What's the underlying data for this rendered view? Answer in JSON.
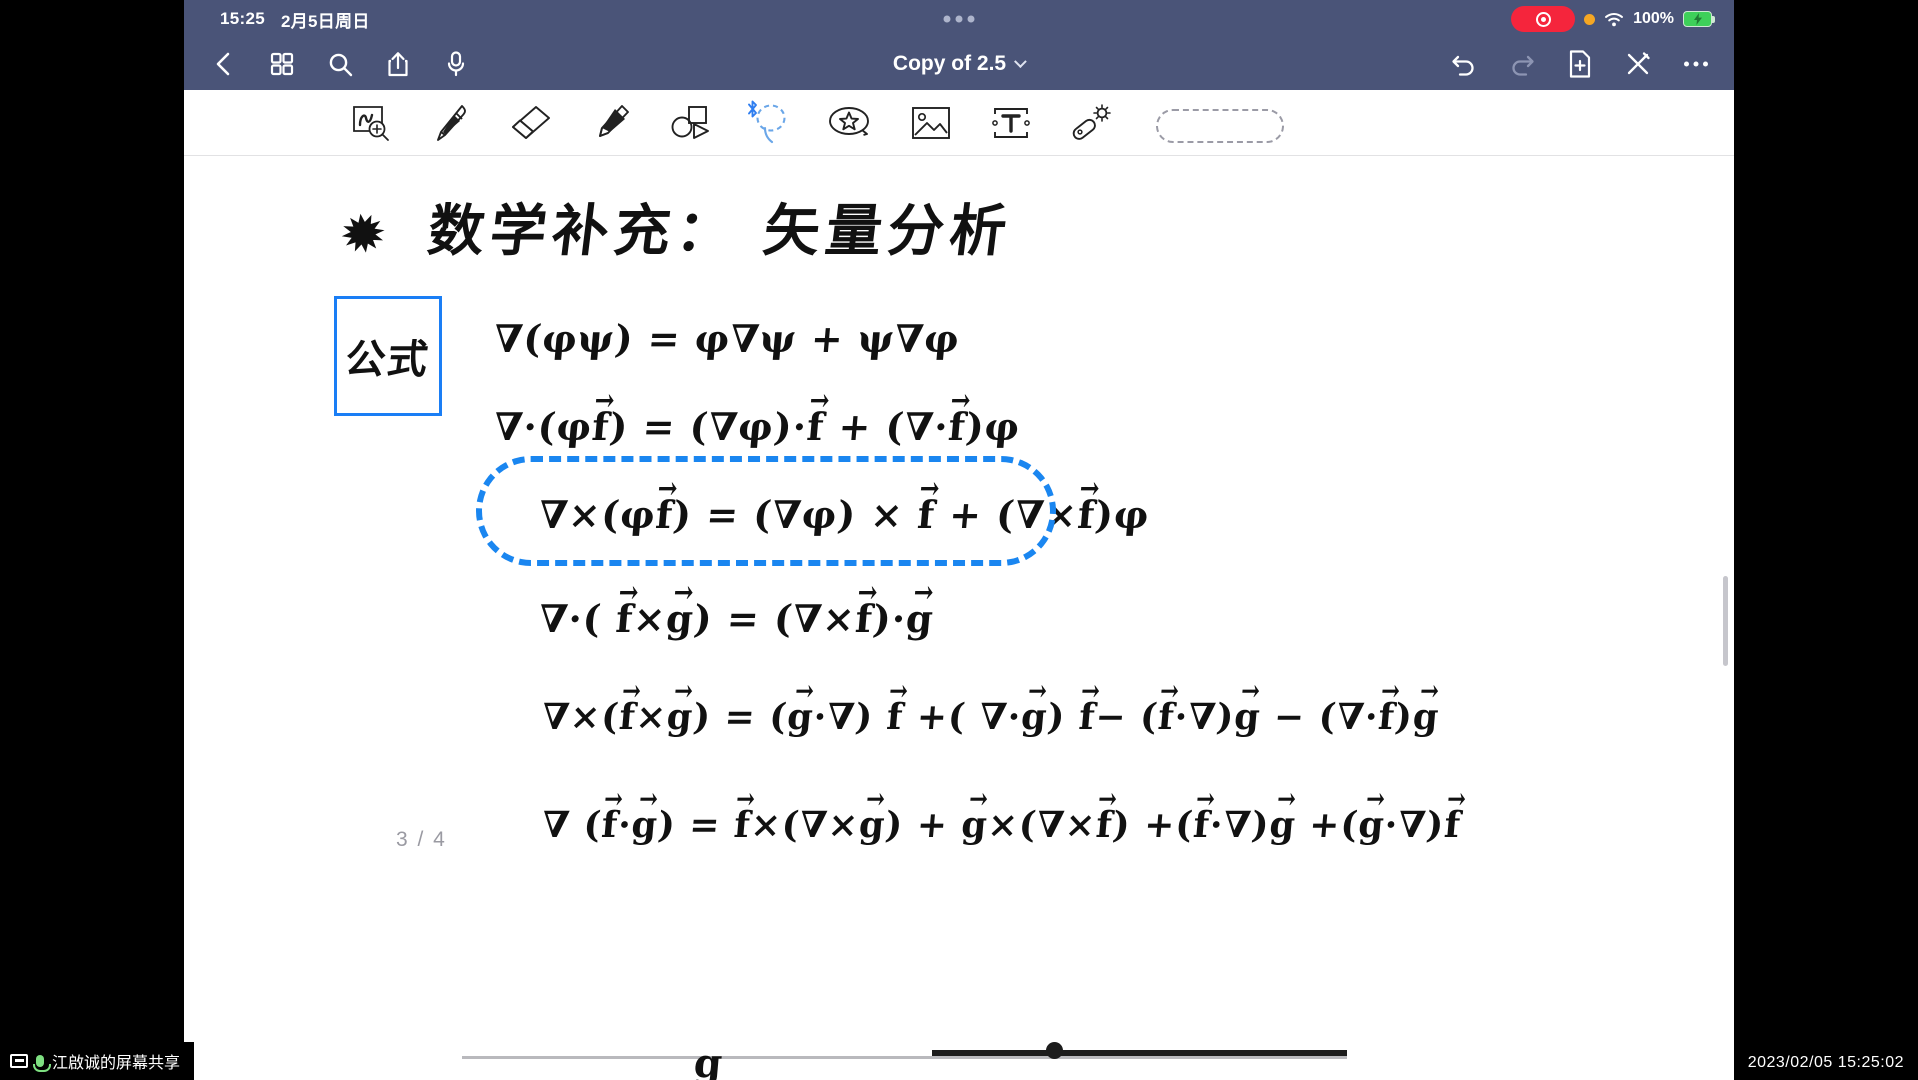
{
  "status_bar": {
    "time": "15:25",
    "date": "2月5日周日",
    "battery_percent": "100%",
    "icons": [
      "recording-indicator",
      "orange-privacy-dot",
      "wifi-icon",
      "battery-charging-icon"
    ]
  },
  "title_bar": {
    "title": "Copy of 2.5",
    "left_icons": [
      "back-chevron-icon",
      "grid-view-icon",
      "search-icon",
      "share-icon",
      "microphone-icon"
    ],
    "right_icons": [
      "undo-icon",
      "redo-icon",
      "add-page-icon",
      "close-pen-icon",
      "more-options-icon"
    ]
  },
  "toolbar": {
    "tools": [
      {
        "name": "zoom-write-tool",
        "selected": false
      },
      {
        "name": "pen-tool",
        "selected": false
      },
      {
        "name": "eraser-tool",
        "selected": false
      },
      {
        "name": "highlighter-tool",
        "selected": false
      },
      {
        "name": "shapes-tool",
        "selected": false
      },
      {
        "name": "lasso-select-tool",
        "selected": true
      },
      {
        "name": "sticker-tool",
        "selected": false
      },
      {
        "name": "image-tool",
        "selected": false
      },
      {
        "name": "text-box-tool",
        "selected": false
      },
      {
        "name": "magic-wand-tool",
        "selected": false
      }
    ],
    "bluetooth_badge": "bluetooth-icon"
  },
  "canvas": {
    "heading_mark": "✹",
    "heading": "数学补充： 矢量分析",
    "label_box": "公式",
    "equations": [
      "∇(φψ) =  φ∇ψ  + ψ∇φ",
      "∇·(φf) =  (∇φ)·f +  (∇·f)φ",
      "∇×(φf) =  (∇φ) × f  + (∇×f)φ",
      "∇·( f×g) =  (∇×f)·g",
      "∇×(f×g)  =  (g·∇) f +( ∇·g) f−  (f·∇)g −  (∇·f)g",
      "∇ (f·g)  =   f×(∇×g) + g×(∇×f) +(f·∇)g +(g·∇)f"
    ],
    "selected_equation_index": 2,
    "page_indicator": "3 / 4",
    "partial_ink": "g"
  },
  "overlay": {
    "share_label": "江啟诚的屏幕共享",
    "timestamp": "2023/02/05 15:25:02"
  },
  "colors": {
    "chrome": "#4a5478",
    "accent_blue": "#1a86f0",
    "recording_red": "#f5253c",
    "battery_green": "#3ed05a"
  }
}
